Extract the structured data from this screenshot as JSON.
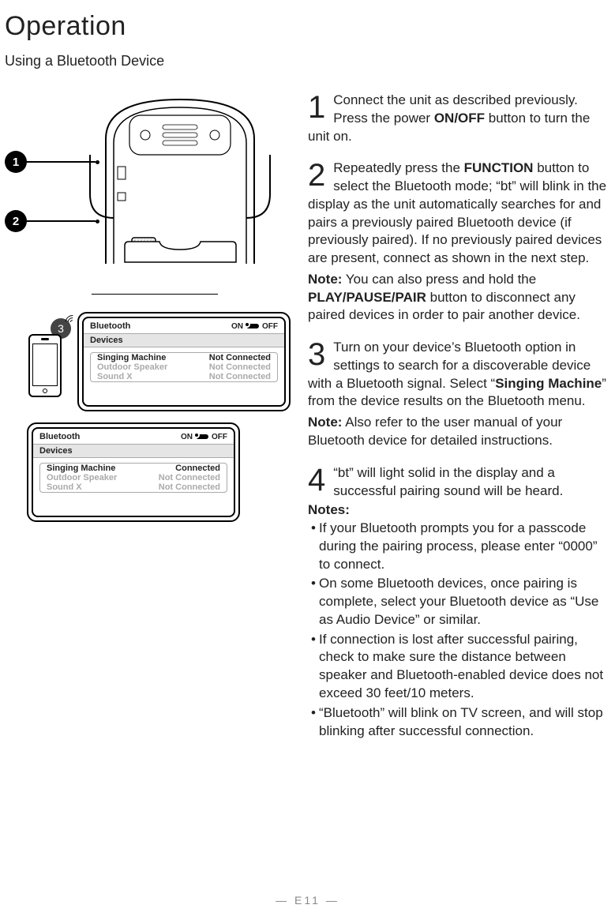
{
  "title": "Operation",
  "section": "Using a Bluetooth Device",
  "callouts": {
    "c1": "1",
    "c2": "2",
    "c3": "3"
  },
  "bt_panel": {
    "header": "Bluetooth",
    "on": "ON",
    "off": "OFF",
    "devices_label": "Devices",
    "rows": [
      {
        "name": "Singing Machine",
        "status_not": "Not Connected",
        "status_con": "Connected"
      },
      {
        "name": "Outdoor Speaker",
        "status": "Not Connected"
      },
      {
        "name": "Sound X",
        "status": "Not Connected"
      }
    ]
  },
  "steps": {
    "s1": {
      "num": "1",
      "pre": "Connect the unit as described previously. Press the power ",
      "bold": "ON/OFF",
      "post": " button to turn the unit on."
    },
    "s2": {
      "num": "2",
      "pre": "Repeatedly press the ",
      "bold": "FUNCTION",
      "post": " button to select the Bluetooth mode; “bt” will blink in the display as the unit automatically searches for and pairs a previously paired Bluetooth device (if previously paired). If no previously paired devices are present, connect as shown in the next step."
    },
    "s2_note": {
      "label": "Note:",
      "pre": " You can also press and hold the ",
      "bold": "PLAY/PAUSE/PAIR",
      "post": " button to disconnect any paired devices in order to pair another device."
    },
    "s3": {
      "num": "3",
      "pre": "Turn on your device’s Bluetooth option in settings to search for a discoverable device with a Bluetooth signal. Select “",
      "bold": "Singing Machine",
      "post": "” from the device results on the Bluetooth menu."
    },
    "s3_note": {
      "label": "Note:",
      "text": " Also refer to the user manual of your Bluetooth device for detailed instructions."
    },
    "s4": {
      "num": "4",
      "text": "“bt” will light solid in the display and a successful pairing sound will be heard."
    },
    "notes_label": "Notes:",
    "bullets": [
      "If your Bluetooth prompts you for a passcode during the pairing process, please enter “0000” to connect.",
      "On some Bluetooth devices, once pairing is complete, select your Bluetooth device as “Use as Audio Device” or similar.",
      "If connection is lost after successful pairing, check to make sure the distance between speaker and Bluetooth-enabled device does not exceed 30 feet/10 meters.",
      "“Bluetooth” will blink on TV screen, and will stop blinking after successful connection."
    ]
  },
  "footer": "— E11 —"
}
